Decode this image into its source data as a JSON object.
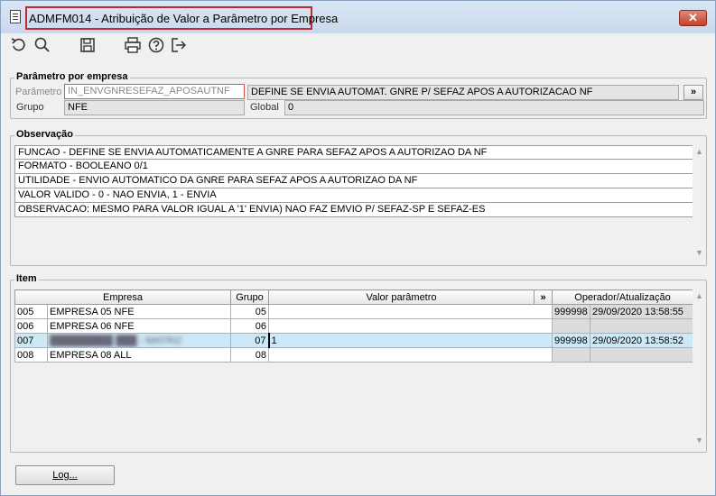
{
  "window": {
    "title": "ADMFM014 - Atribuição de Valor a Parâmetro por Empresa",
    "close_label": "✕"
  },
  "toolbar": {
    "icons": [
      "undo-icon",
      "search-icon",
      "save-icon",
      "print-icon",
      "help-icon",
      "exit-icon"
    ]
  },
  "parametro_group": {
    "title": "Parâmetro por empresa",
    "parametro_label": "Parâmetro",
    "parametro_value": "IN_ENVGNRESEFAZ_APOSAUTNF",
    "descricao_value": "DEFINE SE ENVIA AUTOMAT. GNRE P/ SEFAZ APOS A AUTORIZACAO NF",
    "expand_label": "»",
    "grupo_label": "Grupo",
    "grupo_value": "NFE",
    "global_label": "Global",
    "global_value": "0"
  },
  "observacao_group": {
    "title": "Observação",
    "lines": [
      "FUNCAO - DEFINE SE ENVIA AUTOMATICAMENTE A GNRE PARA SEFAZ APOS A AUTORIZAO DA NF",
      "FORMATO - BOOLEANO 0/1",
      "UTILIDADE - ENVIO AUTOMATICO DA GNRE PARA SEFAZ APOS A AUTORIZAO DA NF",
      "VALOR VALIDO - 0 - NAO ENVIA, 1 - ENVIA",
      "OBSERVACAO: MESMO PARA VALOR  IGUAL A '1' ENVIA) NAO FAZ EMVIO P/ SEFAZ-SP E SEFAZ-ES"
    ]
  },
  "item_group": {
    "title": "Item",
    "columns": {
      "empresa": "Empresa",
      "grupo": "Grupo",
      "valor": "Valor parâmetro",
      "expand": "»",
      "operador": "Operador/Atualização"
    },
    "rows": [
      {
        "code": "005",
        "empresa": "EMPRESA 05 NFE",
        "grupo": "05",
        "valor": "",
        "operador": "999998",
        "data": "29/09/2020 13:58:55"
      },
      {
        "code": "006",
        "empresa": "EMPRESA 06 NFE",
        "grupo": "06",
        "valor": "",
        "operador": "",
        "data": ""
      },
      {
        "code": "007",
        "empresa": "█████████ ███ - MATRIZ",
        "grupo": "07",
        "valor": "1",
        "operador": "999998",
        "data": "29/09/2020 13:58:52"
      },
      {
        "code": "008",
        "empresa": "EMPRESA 08 ALL",
        "grupo": "08",
        "valor": "",
        "operador": "",
        "data": ""
      }
    ]
  },
  "footer": {
    "log_label": "Log..."
  }
}
